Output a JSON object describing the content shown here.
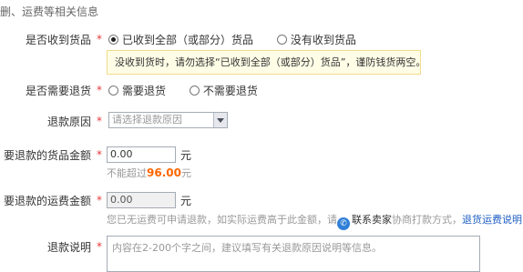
{
  "header": {
    "title": "删、运费等相关信息"
  },
  "received": {
    "label": "是否收到货品",
    "options": [
      "已收到全部（或部分）货品",
      "没有收到货品"
    ],
    "selected": 0,
    "warning": "没收到货时，请勿选择“已收到全部（或部分）货品”，谨防钱货两空。"
  },
  "need_return": {
    "label": "是否需要退货",
    "options": [
      "需要退货",
      "不需要退货"
    ],
    "selected": -1
  },
  "reason": {
    "label": "退款原因",
    "placeholder": "请选择退款原因"
  },
  "goods_amount": {
    "label": "要退款的货品金额",
    "value": "0.00",
    "unit": "元",
    "limit_prefix": "不能超过",
    "limit_value": "96.00",
    "limit_unit": "元"
  },
  "shipping_amount": {
    "label": "要退款的运费金额",
    "value": "0.00",
    "unit": "元",
    "note_before": "您已无运费可申请退款，如实际运费高于此金额，请",
    "contact_label": "联系卖家",
    "note_after": "协商打款方式，",
    "policy_link": "退货运费说明"
  },
  "description": {
    "label": "退款说明",
    "placeholder": "内容在2-200个字之间，建议填写有关退款原因说明等信息。"
  },
  "colors": {
    "required": "#e4393c",
    "amount": "#ff6600",
    "link": "#1d5ec4",
    "warn_bg": "#fffde6"
  },
  "icons": {
    "contact": "contact-seller-icon",
    "select_arrow": "chevron-down-icon"
  }
}
